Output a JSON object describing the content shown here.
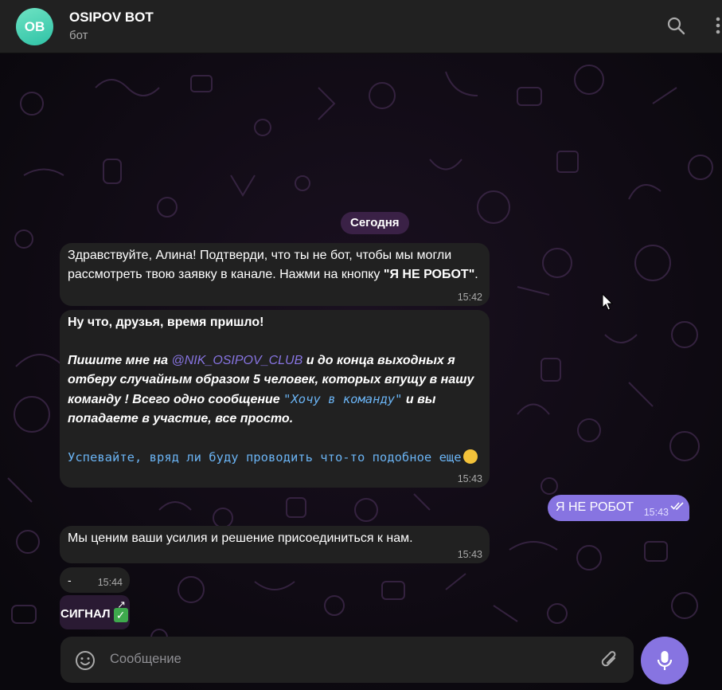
{
  "header": {
    "avatar_initials": "OB",
    "title": "OSIPOV BOT",
    "subtitle": "бот",
    "icons": [
      "search-icon",
      "more-vertical-icon"
    ]
  },
  "date_label": "Сегодня",
  "messages": [
    {
      "text_parts": [
        "Здравствуйте, Алина! Подтверди, что ты не бот, чтобы мы могли рассмотреть твою заявку в канале. Нажми на кнопку ",
        "\"Я НЕ РОБОТ\"",
        "."
      ],
      "time": "15:42"
    },
    {
      "heading": "Ну что, друзья, время пришло!",
      "para_prefix": "Пишите мне на ",
      "mention": "@NIK_OSIPOV_CLUB",
      "para_mid": " и до конца выходных я отберу случайным образом 5 человек, которых впущу в нашу команду ! Всего одно сообщение ",
      "code": "\"Хочу в команду\"",
      "para_suffix": " и вы попадаете в участие, все просто.",
      "footer": "Успевайте, вряд ли буду проводить что-то подобное еще",
      "time": "15:43"
    },
    {
      "text": "Мы ценим ваши усилия и решение присоединиться к нам.",
      "time": "15:43"
    },
    {
      "text": "-",
      "time": "15:44"
    },
    {
      "text": "СИГНАЛ",
      "icon": "check-mark-icon"
    }
  ],
  "outgoing": {
    "text": "Я НЕ РОБОТ",
    "time": "15:43",
    "status_icon": "double-check-icon"
  },
  "composer": {
    "placeholder": "Сообщение",
    "icons": [
      "emoji-icon",
      "attach-icon",
      "microphone-icon"
    ]
  },
  "colors": {
    "accent": "#8774e1",
    "bubble": "#212121",
    "background": "#0d0a12",
    "link": "#6ab3f3"
  }
}
